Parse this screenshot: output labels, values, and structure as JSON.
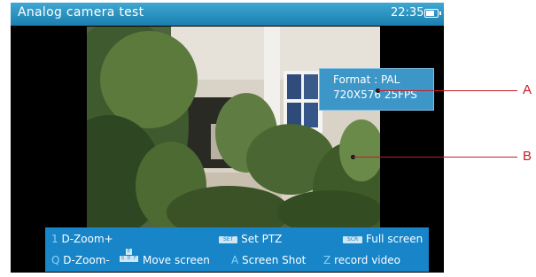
{
  "title_bar": {
    "title": "Analog camera test",
    "time": "22:35",
    "battery_level": 0.85
  },
  "video_info": {
    "format_line": "Format : PAL",
    "resolution_line": "720X576 25FPS"
  },
  "callouts": [
    "A",
    "B"
  ],
  "menu": {
    "zoom_in": {
      "key": "1",
      "label": "D-Zoom+"
    },
    "zoom_out": {
      "key": "Q",
      "label": "D-Zoom-"
    },
    "set_ptz": {
      "key": "SET",
      "label": "Set PTZ"
    },
    "full_screen": {
      "key": "SCR",
      "label": "Full screen"
    },
    "move_screen": {
      "keys": [
        "E",
        "S",
        "D",
        "F"
      ],
      "label": "Move screen"
    },
    "screen_shot": {
      "key": "A",
      "label": "Screen Shot"
    },
    "record_video": {
      "key": "Z",
      "label": "record video"
    }
  },
  "colors": {
    "title_bar": "#1a7fb0",
    "menu_bar": "#1785c8",
    "info_box": "#3d96c8",
    "callout": "#c51d24"
  }
}
